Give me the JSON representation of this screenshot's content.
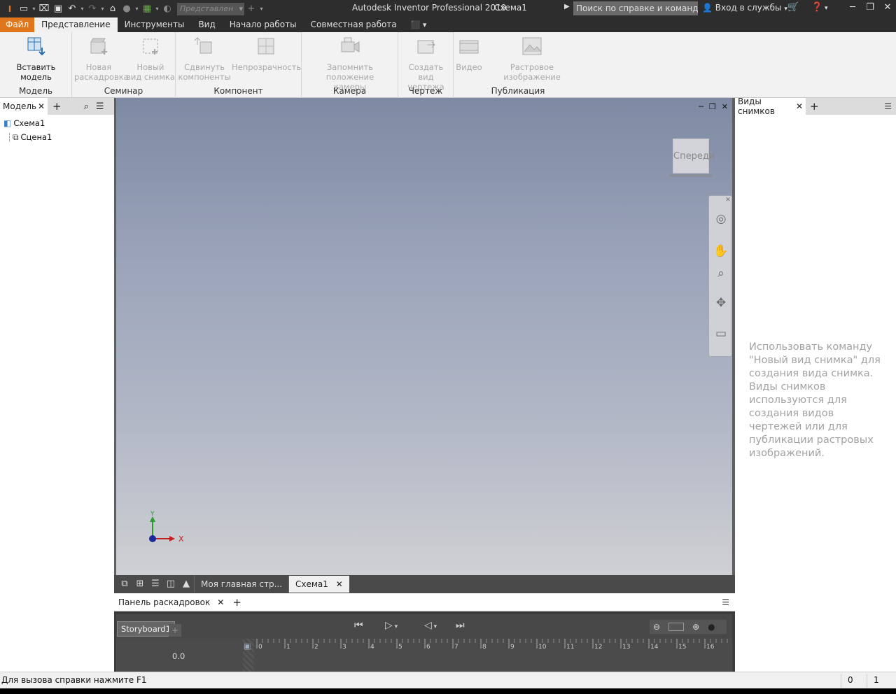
{
  "titlebar": {
    "app_title": "Autodesk Inventor Professional 2019",
    "doc_title": "Схема1",
    "view_select": "Представлен",
    "search_placeholder": "Поиск по справке и командам...",
    "signin": "Вход в службы"
  },
  "menu_tabs": [
    "Файл",
    "Представление",
    "Инструменты",
    "Вид",
    "Начало работы",
    "Совместная работа"
  ],
  "ribbon": {
    "panels": [
      {
        "title": "Модель",
        "buttons": [
          {
            "label1": "Вставить модель",
            "label2": ""
          }
        ]
      },
      {
        "title": "Семинар",
        "buttons": [
          {
            "label1": "Новая",
            "label2": "раскадровка"
          },
          {
            "label1": "Новый",
            "label2": "вид снимка"
          }
        ]
      },
      {
        "title": "Компонент",
        "buttons": [
          {
            "label1": "Сдвинуть",
            "label2": "компоненты"
          },
          {
            "label1": "Непрозрачность",
            "label2": ""
          }
        ]
      },
      {
        "title": "Камера",
        "buttons": [
          {
            "label1": "Запомнить положение",
            "label2": "камеры"
          }
        ]
      },
      {
        "title": "Чертеж",
        "buttons": [
          {
            "label1": "Создать",
            "label2": "вид чертежа"
          }
        ]
      },
      {
        "title": "Публикация",
        "buttons": [
          {
            "label1": "Видео",
            "label2": ""
          },
          {
            "label1": "Растровое изображение",
            "label2": ""
          }
        ]
      }
    ]
  },
  "left_panel": {
    "tab": "Модель",
    "tree": [
      "Схема1",
      "Сцена1"
    ]
  },
  "viewport": {
    "viewcube_face": "Спереди",
    "axis_x": "X",
    "axis_y": "Y"
  },
  "doc_tabs": [
    "Моя главная стр...",
    "Схема1"
  ],
  "storyboard": {
    "panel_title": "Панель раскадровок",
    "storyboard_tab": "Storyboard1",
    "time": "0.0",
    "ruler_labels": [
      "0",
      "1",
      "2",
      "3",
      "4",
      "5",
      "6",
      "7",
      "8",
      "9",
      "10",
      "11",
      "12",
      "13",
      "14",
      "15",
      "16"
    ]
  },
  "right_panel": {
    "tab": "Виды снимков",
    "message": "Использовать команду \"Новый вид снимка\" для создания вида снимка. Виды снимков используются для создания видов чертежей или для публикации растровых изображений."
  },
  "status_bar": {
    "hint": "Для вызова справки нажмите F1",
    "count1": "0",
    "count2": "1"
  }
}
